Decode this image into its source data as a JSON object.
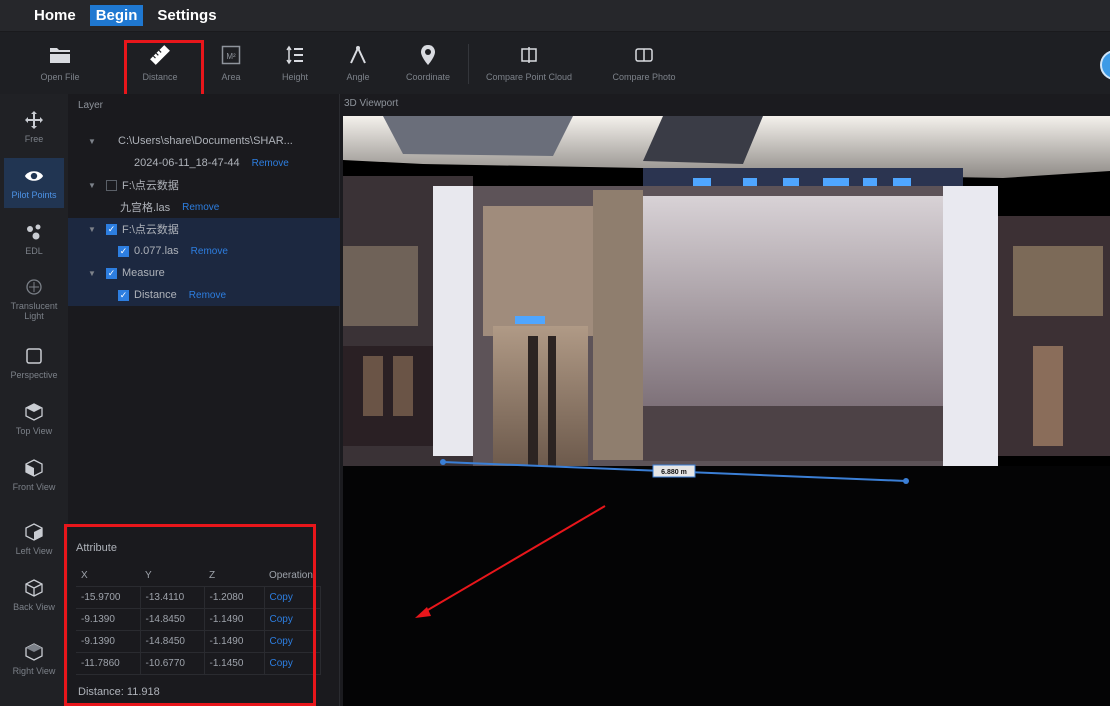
{
  "menubar": {
    "items": [
      "Home",
      "Begin",
      "Settings"
    ],
    "active_index": 1
  },
  "toolbar": {
    "tools": [
      {
        "label": "Open File",
        "icon": "folder-icon"
      },
      {
        "label": "Distance",
        "icon": "ruler-icon"
      },
      {
        "label": "Area",
        "icon": "area-icon"
      },
      {
        "label": "Height",
        "icon": "height-icon"
      },
      {
        "label": "Angle",
        "icon": "angle-icon"
      },
      {
        "label": "Coordinate",
        "icon": "location-pin-icon"
      },
      {
        "label": "Compare Point Cloud",
        "icon": "compare-cloud-icon"
      },
      {
        "label": "Compare Photo",
        "icon": "compare-photo-icon"
      }
    ],
    "area_icon_text": "M²"
  },
  "rail": {
    "items": [
      {
        "label": "Free",
        "icon": "move-icon"
      },
      {
        "label": "Pilot Points",
        "icon": "eye-icon"
      },
      {
        "label": "EDL",
        "icon": "edl-icon"
      },
      {
        "label": "Translucent Light",
        "icon": "light-icon"
      },
      {
        "label": "Perspective",
        "icon": "perspective-icon"
      },
      {
        "label": "Top View",
        "icon": "top-view-icon"
      },
      {
        "label": "Front View",
        "icon": "front-view-icon"
      },
      {
        "label": "Left View",
        "icon": "left-view-icon"
      },
      {
        "label": "Back View",
        "icon": "back-view-icon"
      },
      {
        "label": "Right View",
        "icon": "right-view-icon"
      }
    ],
    "active_index": 1
  },
  "layer_panel": {
    "title": "Layer",
    "rows": [
      {
        "text": "C:\\Users\\share\\Documents\\SHAR...",
        "indent": 1,
        "caret": true,
        "checkbox": null
      },
      {
        "text": "2024-06-11_18-47-44",
        "indent": 2,
        "caret": false,
        "checkbox": null,
        "remove": "Remove"
      },
      {
        "text": "F:\\点云数据",
        "indent": 1,
        "caret": true,
        "checkbox": "off"
      },
      {
        "text": "九宫格.las",
        "indent": 2,
        "caret": false,
        "checkbox": null,
        "remove": "Remove"
      },
      {
        "text": "F:\\点云数据",
        "indent": 1,
        "caret": true,
        "checkbox": "on"
      },
      {
        "text": "0.077.las",
        "indent": 2,
        "caret": false,
        "checkbox": "on",
        "remove": "Remove"
      },
      {
        "text": "Measure",
        "indent": 1,
        "caret": true,
        "checkbox": "on"
      },
      {
        "text": "Distance",
        "indent": 2,
        "caret": false,
        "checkbox": "on",
        "remove": "Remove"
      }
    ]
  },
  "attribute": {
    "title": "Attribute",
    "columns": [
      "X",
      "Y",
      "Z",
      "Operation"
    ],
    "rows": [
      [
        "-15.9700",
        "-13.4110",
        "-1.2080",
        "Copy"
      ],
      [
        "-9.1390",
        "-14.8450",
        "-1.1490",
        "Copy"
      ],
      [
        "-9.1390",
        "-14.8450",
        "-1.1490",
        "Copy"
      ],
      [
        "-11.7860",
        "-10.6770",
        "-1.1450",
        "Copy"
      ]
    ],
    "distance_label": "Distance:",
    "distance_value": "11.918"
  },
  "viewport": {
    "title": "3D Viewport",
    "measure_label": "6.880 m"
  },
  "colors": {
    "accent": "#1f78d1",
    "highlight": "#e8161b",
    "link": "#2d7ee0"
  }
}
